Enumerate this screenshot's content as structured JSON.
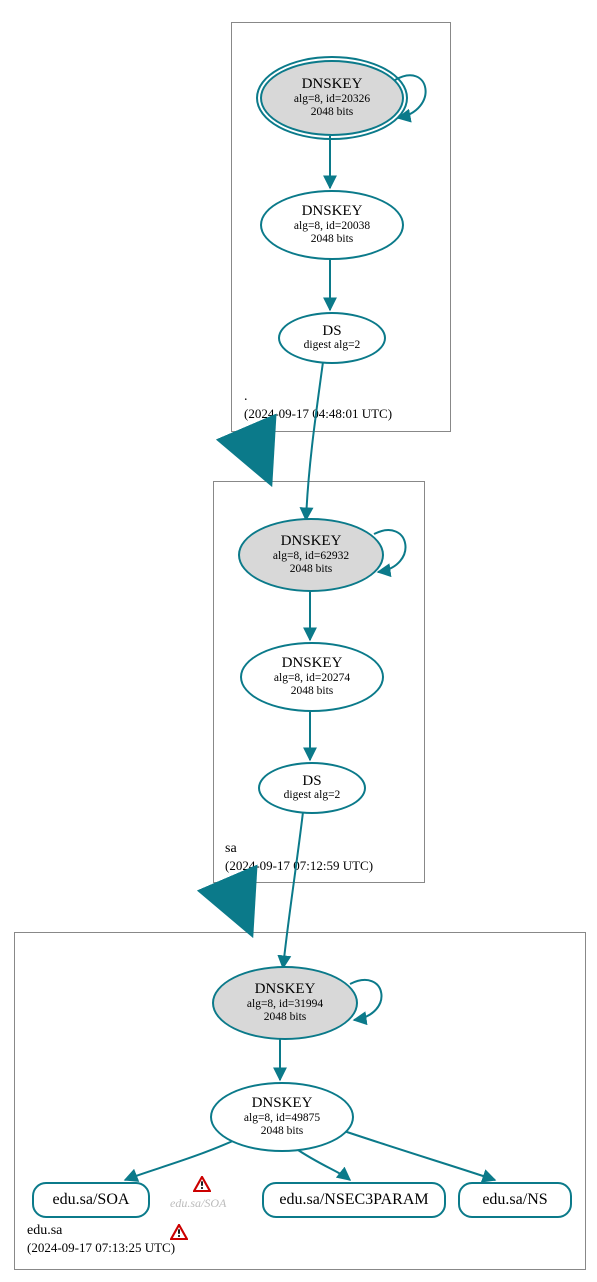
{
  "chart_data": {
    "type": "graph",
    "zones": [
      {
        "name": ".",
        "timestamp": "(2024-09-17 04:48:01 UTC)"
      },
      {
        "name": "sa",
        "timestamp": "(2024-09-17 07:12:59 UTC)"
      },
      {
        "name": "edu.sa",
        "timestamp": "(2024-09-17 07:13:25 UTC)"
      }
    ],
    "nodes": [
      {
        "id": "root-ksk",
        "zone": ".",
        "type": "DNSKEY",
        "alg": 8,
        "keyid": 20326,
        "bits": 2048,
        "ksk": true,
        "double_ring": true
      },
      {
        "id": "root-zsk",
        "zone": ".",
        "type": "DNSKEY",
        "alg": 8,
        "keyid": 20038,
        "bits": 2048,
        "ksk": false
      },
      {
        "id": "root-ds",
        "zone": ".",
        "type": "DS",
        "digest_alg": 2
      },
      {
        "id": "sa-ksk",
        "zone": "sa",
        "type": "DNSKEY",
        "alg": 8,
        "keyid": 62932,
        "bits": 2048,
        "ksk": true
      },
      {
        "id": "sa-zsk",
        "zone": "sa",
        "type": "DNSKEY",
        "alg": 8,
        "keyid": 20274,
        "bits": 2048,
        "ksk": false
      },
      {
        "id": "sa-ds",
        "zone": "sa",
        "type": "DS",
        "digest_alg": 2
      },
      {
        "id": "edu-ksk",
        "zone": "edu.sa",
        "type": "DNSKEY",
        "alg": 8,
        "keyid": 31994,
        "bits": 2048,
        "ksk": true
      },
      {
        "id": "edu-zsk",
        "zone": "edu.sa",
        "type": "DNSKEY",
        "alg": 8,
        "keyid": 49875,
        "bits": 2048,
        "ksk": false
      },
      {
        "id": "edu-soa",
        "zone": "edu.sa",
        "type": "RRset",
        "label": "edu.sa/SOA"
      },
      {
        "id": "edu-soa-ghost",
        "zone": "edu.sa",
        "type": "ghost",
        "label": "edu.sa/SOA",
        "warning": true
      },
      {
        "id": "edu-nsec3",
        "zone": "edu.sa",
        "type": "RRset",
        "label": "edu.sa/NSEC3PARAM"
      },
      {
        "id": "edu-ns",
        "zone": "edu.sa",
        "type": "RRset",
        "label": "edu.sa/NS"
      }
    ],
    "edges": [
      {
        "from": "root-ksk",
        "to": "root-ksk",
        "self": true
      },
      {
        "from": "root-ksk",
        "to": "root-zsk"
      },
      {
        "from": "root-zsk",
        "to": "root-ds"
      },
      {
        "from": "root-ds",
        "to": "sa-ksk"
      },
      {
        "from": "sa-ksk",
        "to": "sa-ksk",
        "self": true
      },
      {
        "from": "sa-ksk",
        "to": "sa-zsk"
      },
      {
        "from": "sa-zsk",
        "to": "sa-ds"
      },
      {
        "from": "sa-ds",
        "to": "edu-ksk"
      },
      {
        "from": "edu-ksk",
        "to": "edu-ksk",
        "self": true
      },
      {
        "from": "edu-ksk",
        "to": "edu-zsk"
      },
      {
        "from": "edu-zsk",
        "to": "edu-soa"
      },
      {
        "from": "edu-zsk",
        "to": "edu-nsec3"
      },
      {
        "from": "edu-zsk",
        "to": "edu-ns"
      }
    ],
    "warnings": [
      {
        "near": "edu-soa-ghost"
      },
      {
        "near": "zone-edu.sa-label"
      }
    ],
    "colors": {
      "stroke": "#0b7a8a",
      "ksk_fill": "#d8d8d8",
      "warn": "#cc0000"
    }
  },
  "labels": {
    "dnskey": "DNSKEY",
    "ds": "DS",
    "root_ksk_sub": "alg=8, id=20326",
    "root_ksk_bits": "2048 bits",
    "root_zsk_sub": "alg=8, id=20038",
    "root_zsk_bits": "2048 bits",
    "root_ds_sub": "digest alg=2",
    "sa_ksk_sub": "alg=8, id=62932",
    "sa_ksk_bits": "2048 bits",
    "sa_zsk_sub": "alg=8, id=20274",
    "sa_zsk_bits": "2048 bits",
    "sa_ds_sub": "digest alg=2",
    "edu_ksk_sub": "alg=8, id=31994",
    "edu_ksk_bits": "2048 bits",
    "edu_zsk_sub": "alg=8, id=49875",
    "edu_zsk_bits": "2048 bits",
    "edu_soa": "edu.sa/SOA",
    "edu_soa_ghost": "edu.sa/SOA",
    "edu_nsec3": "edu.sa/NSEC3PARAM",
    "edu_ns": "edu.sa/NS",
    "zone_root_name": ".",
    "zone_root_ts": "(2024-09-17 04:48:01 UTC)",
    "zone_sa_name": "sa",
    "zone_sa_ts": "(2024-09-17 07:12:59 UTC)",
    "zone_edu_name": "edu.sa",
    "zone_edu_ts": "(2024-09-17 07:13:25 UTC)"
  }
}
